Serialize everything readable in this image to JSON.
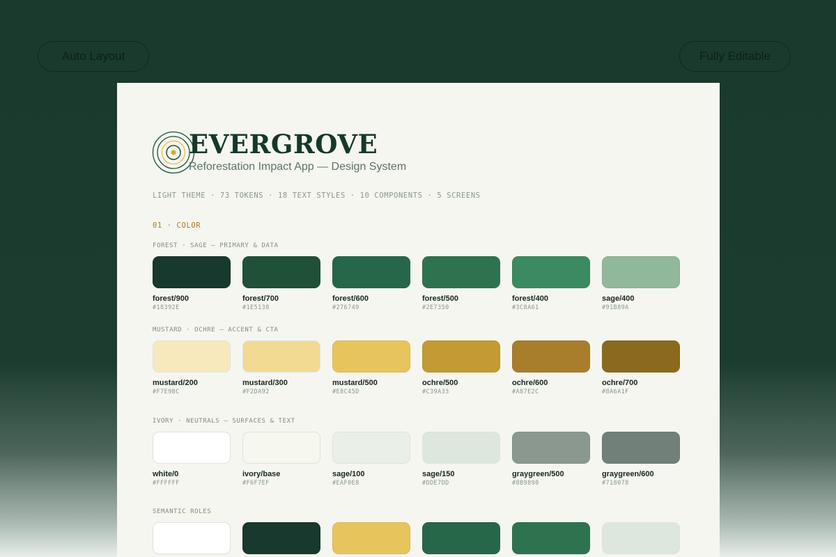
{
  "colors": {
    "background": "#1a3a2e",
    "card": "#f5f6ef",
    "accent": "#a8792a",
    "brand": "#16382c"
  },
  "pills": {
    "left_label": "Auto Layout",
    "right_label": "Fully Editable"
  },
  "header": {
    "logo_icon": "concentric-rings-icon",
    "brand": "EVERGROVE",
    "subtitle": "Reforestation Impact App — Design System",
    "meta": "LIGHT THEME · 73 TOKENS · 18 TEXT STYLES · 10 COMPONENTS · 5 SCREENS"
  },
  "section": {
    "title": "01 · COLOR"
  },
  "groups": [
    {
      "label": "FOREST · SAGE — PRIMARY & DATA",
      "swatches": [
        {
          "name": "forest/900",
          "hex": "#18392E",
          "color": "#18392e"
        },
        {
          "name": "forest/700",
          "hex": "#1E5138",
          "color": "#1e5138"
        },
        {
          "name": "forest/600",
          "hex": "#276749",
          "color": "#276749"
        },
        {
          "name": "forest/500",
          "hex": "#2E7350",
          "color": "#2e7350"
        },
        {
          "name": "forest/400",
          "hex": "#3C8A61",
          "color": "#3c8a61"
        },
        {
          "name": "sage/400",
          "hex": "#91B89A",
          "color": "#91b89a"
        }
      ]
    },
    {
      "label": "MUSTARD · OCHRE — ACCENT & CTA",
      "swatches": [
        {
          "name": "mustard/200",
          "hex": "#F7E9BC",
          "color": "#f7e9bc"
        },
        {
          "name": "mustard/300",
          "hex": "#F2DA92",
          "color": "#f2da92"
        },
        {
          "name": "mustard/500",
          "hex": "#E8C45D",
          "color": "#e8c45d"
        },
        {
          "name": "ochre/500",
          "hex": "#C39A33",
          "color": "#c39a33"
        },
        {
          "name": "ochre/600",
          "hex": "#A87E2C",
          "color": "#a87e2c"
        },
        {
          "name": "ochre/700",
          "hex": "#8A6A1F",
          "color": "#8a6a1f"
        }
      ]
    },
    {
      "label": "IVORY · NEUTRALS — SURFACES & TEXT",
      "swatches": [
        {
          "name": "white/0",
          "hex": "#FFFFFF",
          "color": "#ffffff"
        },
        {
          "name": "ivory/base",
          "hex": "#F6F7EF",
          "color": "#f6f7ef"
        },
        {
          "name": "sage/100",
          "hex": "#EAF0E8",
          "color": "#eaf0e8"
        },
        {
          "name": "sage/150",
          "hex": "#DDE7DD",
          "color": "#dde7dd"
        },
        {
          "name": "graygreen/500",
          "hex": "#8B9890",
          "color": "#8b9890"
        },
        {
          "name": "graygreen/600",
          "hex": "#718078",
          "color": "#718078"
        }
      ]
    },
    {
      "label": "SEMANTIC ROLES",
      "swatches": [
        {
          "color": "#ffffff"
        },
        {
          "color": "#18392e"
        },
        {
          "color": "#e8c45d"
        },
        {
          "color": "#276749"
        },
        {
          "color": "#2e7350"
        },
        {
          "color": "#dde7dd"
        }
      ]
    }
  ]
}
